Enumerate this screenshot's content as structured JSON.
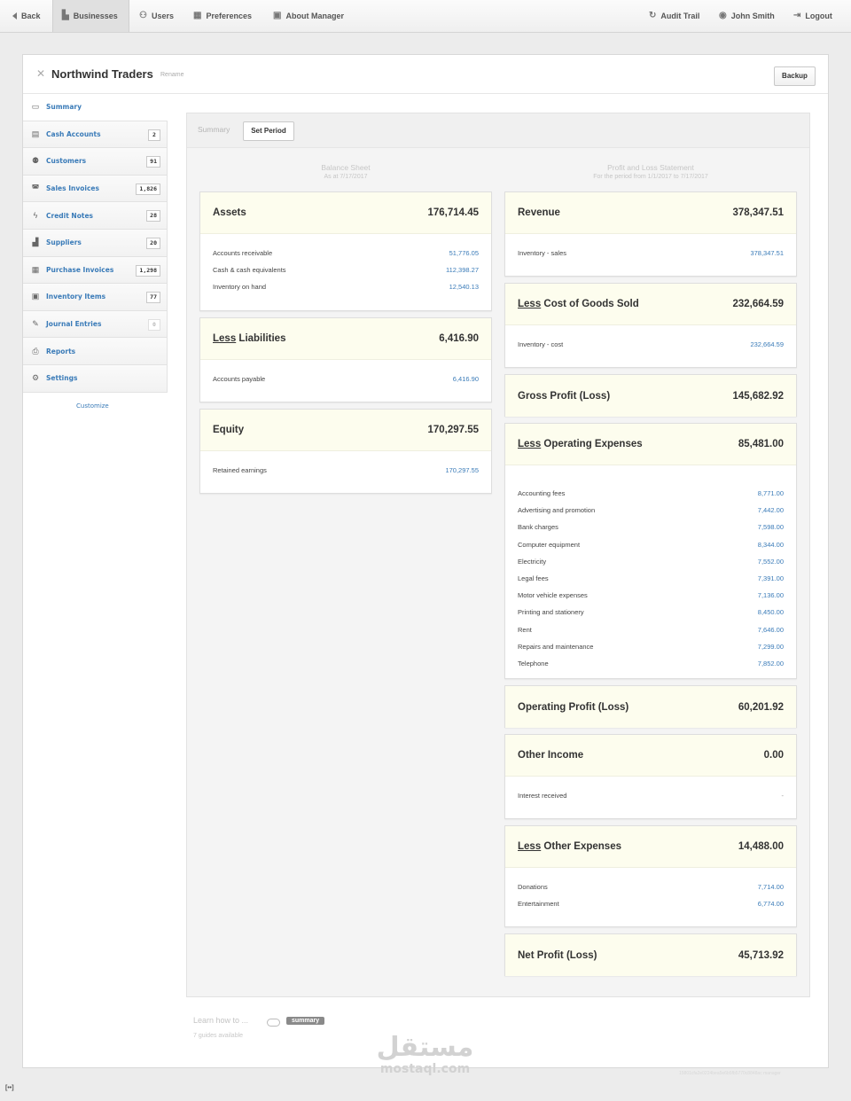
{
  "topbar": {
    "back": "Back",
    "businesses": "Businesses",
    "users": "Users",
    "preferences": "Preferences",
    "about": "About Manager",
    "audit_trail": "Audit Trail",
    "user": "John Smith",
    "logout": "Logout"
  },
  "business": {
    "name": "Northwind Traders",
    "rename": "Rename",
    "backup": "Backup"
  },
  "sidebar": {
    "items": [
      {
        "label": "Summary",
        "icon": "monitor-icon",
        "count": ""
      },
      {
        "label": "Cash Accounts",
        "icon": "cash-icon",
        "count": "2"
      },
      {
        "label": "Customers",
        "icon": "people-icon",
        "count": "91"
      },
      {
        "label": "Sales Invoices",
        "icon": "inbox-icon",
        "count": "1,826"
      },
      {
        "label": "Credit Notes",
        "icon": "lightning-icon",
        "count": "28"
      },
      {
        "label": "Suppliers",
        "icon": "factory-icon",
        "count": "20"
      },
      {
        "label": "Purchase Invoices",
        "icon": "calendar-icon",
        "count": "1,298"
      },
      {
        "label": "Inventory Items",
        "icon": "box-icon",
        "count": "77"
      },
      {
        "label": "Journal Entries",
        "icon": "pen-icon",
        "count": "0"
      },
      {
        "label": "Reports",
        "icon": "printer-icon",
        "count": ""
      },
      {
        "label": "Settings",
        "icon": "gears-icon",
        "count": ""
      }
    ],
    "customize": "Customize"
  },
  "tabs": {
    "summary": "Summary",
    "set_period": "Set Period"
  },
  "balance_sheet": {
    "title": "Balance Sheet",
    "subtitle": "As at 7/17/2017",
    "assets": {
      "title": "Assets",
      "total": "176,714.45",
      "rows": [
        {
          "label": "Accounts receivable",
          "value": "51,776.05"
        },
        {
          "label": "Cash & cash equivalents",
          "value": "112,398.27"
        },
        {
          "label": "Inventory on hand",
          "value": "12,540.13"
        }
      ]
    },
    "liabilities": {
      "prefix": "Less",
      "title": "Liabilities",
      "total": "6,416.90",
      "rows": [
        {
          "label": "Accounts payable",
          "value": "6,416.90"
        }
      ]
    },
    "equity": {
      "title": "Equity",
      "total": "170,297.55",
      "rows": [
        {
          "label": "Retained earnings",
          "value": "170,297.55"
        }
      ]
    }
  },
  "pnl": {
    "title": "Profit and Loss Statement",
    "subtitle": "For the period from 1/1/2017 to 7/17/2017",
    "revenue": {
      "title": "Revenue",
      "total": "378,347.51",
      "rows": [
        {
          "label": "Inventory - sales",
          "value": "378,347.51"
        }
      ]
    },
    "cogs": {
      "prefix": "Less",
      "title": "Cost of Goods Sold",
      "total": "232,664.59",
      "rows": [
        {
          "label": "Inventory - cost",
          "value": "232,664.59"
        }
      ]
    },
    "gross": {
      "title": "Gross Profit (Loss)",
      "total": "145,682.92"
    },
    "opex": {
      "prefix": "Less",
      "title": "Operating Expenses",
      "total": "85,481.00",
      "rows": [
        {
          "label": "Accounting fees",
          "value": "8,771.00"
        },
        {
          "label": "Advertising and promotion",
          "value": "7,442.00"
        },
        {
          "label": "Bank charges",
          "value": "7,598.00"
        },
        {
          "label": "Computer equipment",
          "value": "8,344.00"
        },
        {
          "label": "Electricity",
          "value": "7,552.00"
        },
        {
          "label": "Legal fees",
          "value": "7,391.00"
        },
        {
          "label": "Motor vehicle expenses",
          "value": "7,136.00"
        },
        {
          "label": "Printing and stationery",
          "value": "8,450.00"
        },
        {
          "label": "Rent",
          "value": "7,646.00"
        },
        {
          "label": "Repairs and maintenance",
          "value": "7,299.00"
        },
        {
          "label": "Telephone",
          "value": "7,852.00"
        }
      ]
    },
    "operating": {
      "title": "Operating Profit (Loss)",
      "total": "60,201.92"
    },
    "other_income": {
      "title": "Other Income",
      "total": "0.00",
      "rows": [
        {
          "label": "Interest received",
          "value": "-"
        }
      ]
    },
    "other_expenses": {
      "prefix": "Less",
      "title": "Other Expenses",
      "total": "14,488.00",
      "rows": [
        {
          "label": "Donations",
          "value": "7,714.00"
        },
        {
          "label": "Entertainment",
          "value": "6,774.00"
        }
      ]
    },
    "net": {
      "title": "Net Profit (Loss)",
      "total": "45,713.92"
    }
  },
  "learn": {
    "text": "Learn how to ...",
    "pill": "summary",
    "sub": "7 guides available"
  },
  "footer_code": "15801cfa2e0224bea5e6b5fb5770c8848ac manager",
  "watermark": {
    "arabic": "مستقل",
    "latin": "mostaql.com"
  },
  "corner": "[••]",
  "colors": {
    "link": "#3a7bb8",
    "card_head": "#fdfdee"
  }
}
